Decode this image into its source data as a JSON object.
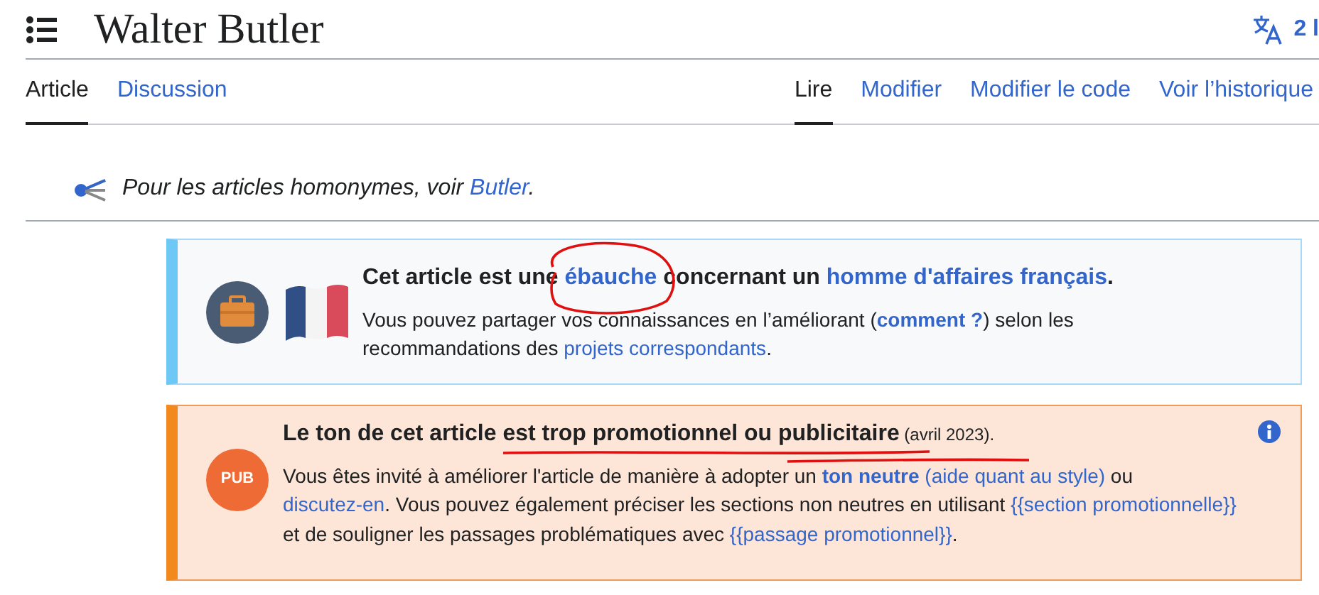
{
  "header": {
    "title": "Walter Butler",
    "language_button": "2 l"
  },
  "namespace_tabs": [
    {
      "label": "Article",
      "selected": true
    },
    {
      "label": "Discussion",
      "selected": false
    }
  ],
  "view_tabs": [
    {
      "label": "Lire",
      "selected": true
    },
    {
      "label": "Modifier",
      "selected": false
    },
    {
      "label": "Modifier le code",
      "selected": false
    },
    {
      "label": "Voir l’historique",
      "selected": false
    }
  ],
  "hatnote": [
    {
      "text": "Pour les articles homonymes, voir ",
      "kind": "text"
    },
    {
      "text": "Butler",
      "kind": "link"
    },
    {
      "text": ".",
      "kind": "text"
    }
  ],
  "banners": [
    {
      "kind": "stub",
      "title": [
        {
          "text": "Cet article est une ",
          "kind": "text"
        },
        {
          "text": "ébauche",
          "kind": "link",
          "circled": true
        },
        {
          "text": " concernant un ",
          "kind": "text"
        },
        {
          "text": "homme d'affaires français",
          "kind": "link"
        },
        {
          "text": ".",
          "kind": "text"
        }
      ],
      "body": [
        {
          "text": "Vous pouvez partager vos connaissances en l’améliorant (",
          "kind": "text"
        },
        {
          "text": "comment ?",
          "kind": "strong-link"
        },
        {
          "text": ") selon les recommandations des ",
          "kind": "text"
        },
        {
          "text": "projets correspondants",
          "kind": "link"
        },
        {
          "text": ".",
          "kind": "text"
        }
      ]
    },
    {
      "kind": "promo",
      "icon_label": "PUB",
      "title": [
        {
          "text": "Le ton de cet article ",
          "kind": "text"
        },
        {
          "text": "est trop promotionnel ou publicitaire",
          "kind": "text",
          "underlined": true
        },
        {
          "text": " (avril 2023).",
          "kind": "small"
        }
      ],
      "body": [
        {
          "text": "Vous êtes invité à améliorer l'article de manière à adopter un ",
          "kind": "text"
        },
        {
          "text": "ton neutre",
          "kind": "strong-link"
        },
        {
          "text": " (aide quant au style)",
          "kind": "link"
        },
        {
          "text": " ou ",
          "kind": "text"
        },
        {
          "text": "discutez-en",
          "kind": "link"
        },
        {
          "text": ". Vous pouvez également préciser les sections non neutres en utilisant ",
          "kind": "text"
        },
        {
          "text": "{{section promotionnelle}}",
          "kind": "link"
        },
        {
          "text": " et de souligner les passages problématiques avec ",
          "kind": "text"
        },
        {
          "text": "{{passage promotionnel}}",
          "kind": "link"
        },
        {
          "text": ".",
          "kind": "text"
        }
      ]
    }
  ]
}
